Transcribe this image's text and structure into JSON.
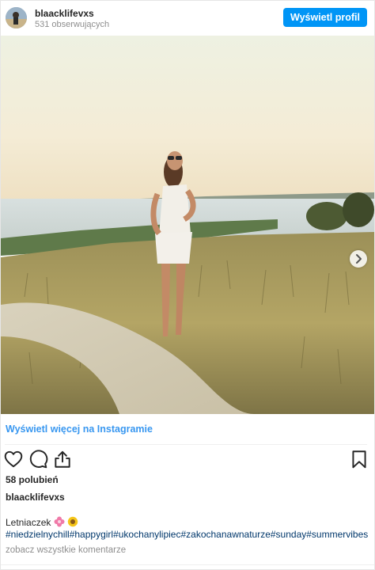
{
  "header": {
    "username": "blaacklifevxs",
    "followers": "531 obserwujących",
    "profile_button": "Wyświetl profil"
  },
  "photo": {
    "carousel_total": 2,
    "carousel_active": 1
  },
  "view_more_link": "Wyświetl więcej na Instagramie",
  "actions": {
    "icons": [
      "heart-icon",
      "comment-icon",
      "share-icon",
      "bookmark-icon"
    ]
  },
  "likes": "58 polubień",
  "caption": {
    "username": "blaacklifevxs",
    "text": "Letniaczek",
    "emojis": [
      "flower-emoji",
      "sunflower-emoji"
    ],
    "hashtags": "#niedzielnychill#happygirl#ukochanylipiec#zakochanawnaturze#sunday#summervibes"
  },
  "comments_link": "zobacz wszystkie komentarze",
  "colors": {
    "accent": "#0095f6",
    "link": "#3897f0",
    "hashtag": "#00376b",
    "muted": "#8e8e8e"
  }
}
